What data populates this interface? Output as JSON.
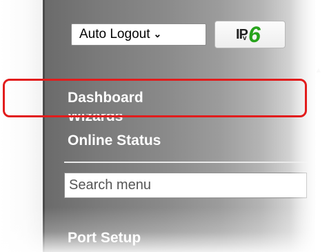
{
  "header": {
    "logout_select": {
      "value": "Auto Logout",
      "options": [
        "Auto Logout"
      ]
    },
    "ipv6_button": {
      "ip_text": "IP",
      "v_text": "v",
      "six_text": "6",
      "six_color": "#27a31c"
    }
  },
  "sidebar": {
    "items_top": [
      {
        "label": "Dashboard"
      },
      {
        "label": "Wizards"
      },
      {
        "label": "Online Status"
      }
    ],
    "search": {
      "placeholder": "Search menu",
      "value": ""
    },
    "items_bottom": [
      {
        "label": "Port Setup"
      }
    ]
  },
  "annotation": {
    "highlight_color": "#e21c1c",
    "highlighted_item": "Dashboard"
  },
  "icons": {
    "select_chevron": "chevron-down-icon",
    "scroll_up": "scroll-up-arrow-icon"
  }
}
